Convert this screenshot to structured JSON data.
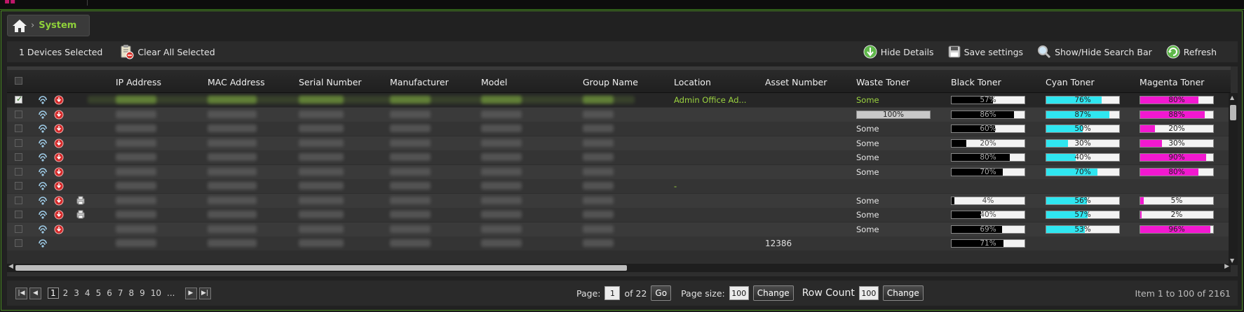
{
  "breadcrumb": {
    "current": "System"
  },
  "toolbar": {
    "selected_count": "1 Devices Selected",
    "clear_all": "Clear All Selected",
    "hide_details": "Hide Details",
    "save_settings": "Save settings",
    "show_hide_search": "Show/Hide Search Bar",
    "refresh": "Refresh"
  },
  "columns": {
    "ip": "IP Address",
    "mac": "MAC Address",
    "serial": "Serial Number",
    "manufacturer": "Manufacturer",
    "model": "Model",
    "group": "Group Name",
    "location": "Location",
    "asset": "Asset Number",
    "waste": "Waste Toner",
    "black": "Black Toner",
    "cyan": "Cyan Toner",
    "magenta": "Magenta Toner"
  },
  "rows": [
    {
      "selected": true,
      "delete": true,
      "extra_icon": false,
      "location": "Admin Office Ad...",
      "asset": "",
      "waste": "Some",
      "waste_pct": null,
      "black": 57,
      "cyan": 76,
      "magenta": 80
    },
    {
      "selected": false,
      "delete": true,
      "extra_icon": false,
      "location": "",
      "asset": "",
      "waste": "",
      "waste_pct": 100,
      "black": 86,
      "cyan": 87,
      "magenta": 88
    },
    {
      "selected": false,
      "delete": true,
      "extra_icon": false,
      "location": "",
      "asset": "",
      "waste": "Some",
      "waste_pct": null,
      "black": 60,
      "cyan": 50,
      "magenta": 20
    },
    {
      "selected": false,
      "delete": true,
      "extra_icon": false,
      "location": "",
      "asset": "",
      "waste": "Some",
      "waste_pct": null,
      "black": 20,
      "cyan": 30,
      "magenta": 30
    },
    {
      "selected": false,
      "delete": true,
      "extra_icon": false,
      "location": "",
      "asset": "",
      "waste": "Some",
      "waste_pct": null,
      "black": 80,
      "cyan": 40,
      "magenta": 90
    },
    {
      "selected": false,
      "delete": true,
      "extra_icon": false,
      "location": "",
      "asset": "",
      "waste": "Some",
      "waste_pct": null,
      "black": 70,
      "cyan": 70,
      "magenta": 80
    },
    {
      "selected": false,
      "delete": true,
      "extra_icon": false,
      "location": "-",
      "asset": "",
      "waste": "",
      "waste_pct": null,
      "black": null,
      "cyan": null,
      "magenta": null
    },
    {
      "selected": false,
      "delete": true,
      "extra_icon": true,
      "location": "",
      "asset": "",
      "waste": "Some",
      "waste_pct": null,
      "black": 4,
      "cyan": 56,
      "magenta": 5
    },
    {
      "selected": false,
      "delete": true,
      "extra_icon": true,
      "location": "",
      "asset": "",
      "waste": "Some",
      "waste_pct": null,
      "black": 40,
      "cyan": 57,
      "magenta": 2
    },
    {
      "selected": false,
      "delete": true,
      "extra_icon": false,
      "location": "",
      "asset": "",
      "waste": "Some",
      "waste_pct": null,
      "black": 69,
      "cyan": 53,
      "magenta": 96
    },
    {
      "selected": false,
      "delete": false,
      "extra_icon": false,
      "location": "",
      "asset": "12386",
      "waste": "",
      "waste_pct": null,
      "black": 71,
      "cyan": null,
      "magenta": null
    }
  ],
  "pager": {
    "pages": [
      "1",
      "2",
      "3",
      "4",
      "5",
      "6",
      "7",
      "8",
      "9",
      "10",
      "..."
    ],
    "current_page_index": 0,
    "page_label": "Page:",
    "page_value": "1",
    "of_label": "of 22",
    "go": "Go",
    "page_size_label": "Page size:",
    "page_size_value": "100",
    "change": "Change",
    "row_count_label": "Row Count",
    "row_count_value": "100",
    "summary": "Item 1 to 100 of 2161"
  },
  "colors": {
    "accent": "#8fd13a",
    "cyan": "#2fe6f0",
    "magenta": "#f218d0",
    "border": "#4a8a22"
  }
}
